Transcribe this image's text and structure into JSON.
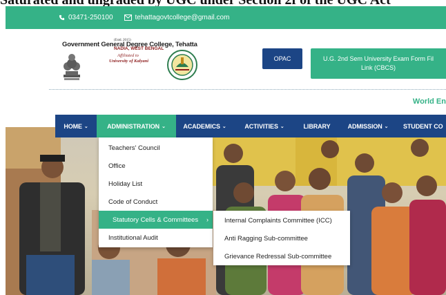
{
  "top_heading": "Saturated and ungraded by UGC under Section 2f of the UGC Act",
  "contact": {
    "phone": "03471-250100",
    "email": "tehattagovtcollege@gmail.com"
  },
  "college": {
    "name": "Government General Degree College, Tehatta",
    "estd": "(Estd. 2015)",
    "district": "NADIA, WEST BENGAL",
    "affiliated": "Affiliated to",
    "university": "University of Kalyani"
  },
  "buttons": {
    "opac": "OPAC",
    "ug_exam_line1": "U.G. 2nd Sem University Exam Form Fil",
    "ug_exam_line2": "Link (CBCS)"
  },
  "marquee": "World En",
  "nav": [
    {
      "label": "HOME",
      "chevron": true
    },
    {
      "label": "ADMINISTRATION",
      "chevron": true
    },
    {
      "label": "ACADEMICS",
      "chevron": true
    },
    {
      "label": "ACTIVITIES",
      "chevron": true
    },
    {
      "label": "LIBRARY",
      "chevron": false
    },
    {
      "label": "ADMISSION",
      "chevron": true
    },
    {
      "label": "STUDENT CO",
      "chevron": false
    }
  ],
  "admin_menu": [
    "Teachers' Council",
    "Office",
    "Holiday List",
    "Code of Conduct",
    "Statutory Cells & Committees",
    "Institutional Audit"
  ],
  "statutory_submenu": [
    "Internal Complaints Committee (ICC)",
    "Anti Ragging Sub-committee",
    "Grievance Redressal Sub-committee"
  ],
  "colors": {
    "green": "#35b287",
    "navy": "#1c4585",
    "maroon": "#8b1a1a"
  }
}
